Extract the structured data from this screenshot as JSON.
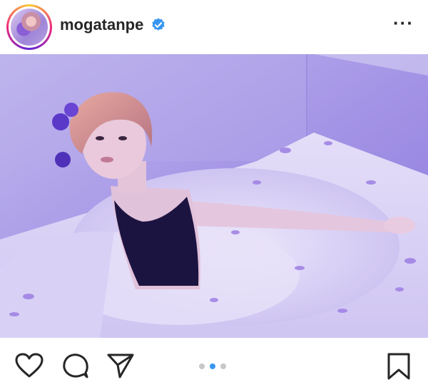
{
  "post": {
    "username": "mogatanpe",
    "verified": true
  },
  "icons": {
    "avatar": "profile-avatar",
    "verified": "verified-badge-icon",
    "more": "more-options-icon",
    "like": "heart-icon",
    "comment": "comment-icon",
    "share": "send-icon",
    "save": "bookmark-icon"
  },
  "carousel": {
    "total": 3,
    "active_index": 1
  },
  "colors": {
    "verified": "#3897f0",
    "active_dot": "#3897f0",
    "inactive_dot": "#c7c7c7",
    "text": "#262626"
  }
}
